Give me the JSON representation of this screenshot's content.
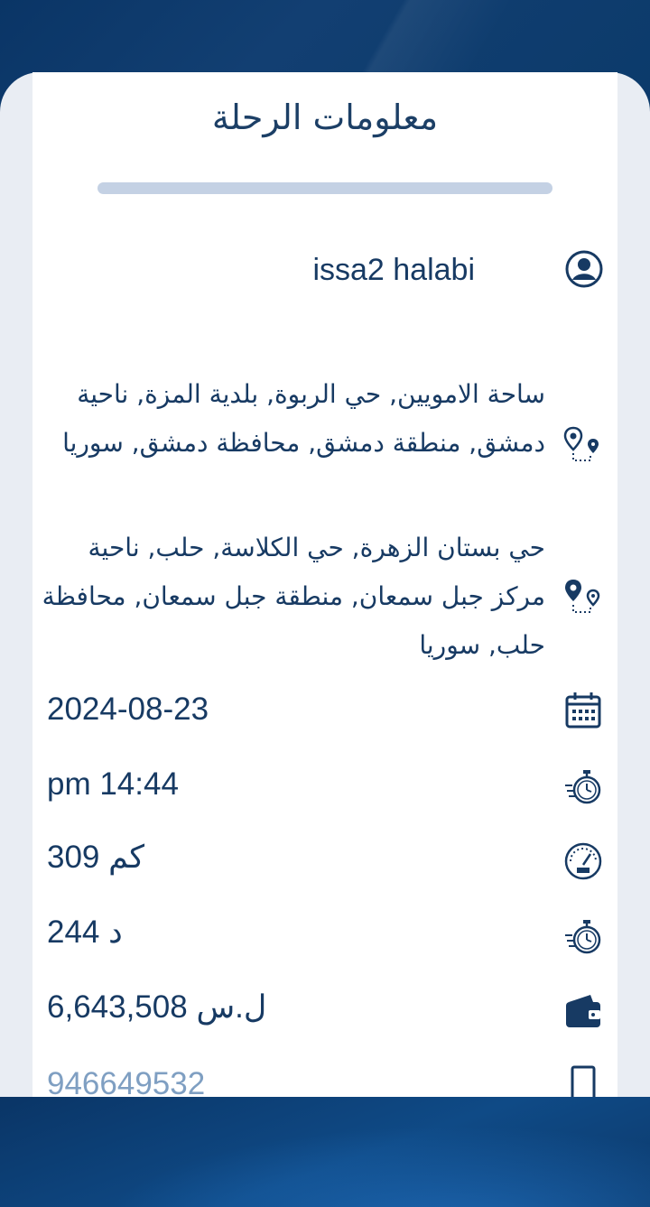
{
  "title": "معلومات الرحلة",
  "passenger": {
    "name": "issa2 halabi",
    "icon": "user-circle-icon"
  },
  "pickup": {
    "address": "ساحة الامويين, حي الربوة, بلدية المزة, ناحية دمشق, منطقة دمشق, محافظة دمشق, سوريا",
    "icon": "route-start-icon"
  },
  "dropoff": {
    "address": "حي بستان الزهرة, حي الكلاسة, حلب, ناحية مركز جبل سمعان, منطقة جبل سمعان, محافظة حلب, سوريا",
    "icon": "route-end-icon"
  },
  "date": {
    "value": "2024-08-23",
    "icon": "calendar-icon"
  },
  "time": {
    "value": "pm 14:44",
    "icon": "stopwatch-icon"
  },
  "distance": {
    "value": "309 كم",
    "icon": "speedometer-icon"
  },
  "duration": {
    "value": "244 د",
    "icon": "stopwatch-icon"
  },
  "price": {
    "value": "6,643,508 ل.س",
    "icon": "wallet-icon"
  },
  "phone": {
    "value": "946649532",
    "icon": "phone-icon"
  },
  "colors": {
    "primary": "#173a63",
    "accent": "#1c3f66",
    "divider": "#c4d1e4",
    "muted": "#7f9fc2",
    "header_bg": "#0d3a6b"
  }
}
